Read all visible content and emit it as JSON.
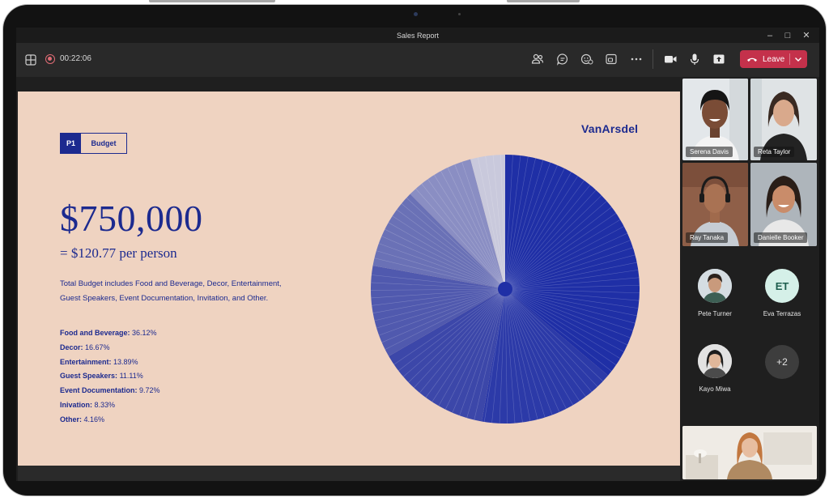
{
  "window": {
    "title": "Sales Report"
  },
  "toolbar": {
    "timer": "00:22:06",
    "leave_label": "Leave",
    "icons": [
      "grid-icon",
      "record-icon",
      "people-icon",
      "chat-icon",
      "reactions-icon",
      "view-icon",
      "more-icon",
      "camera-icon",
      "mic-icon",
      "share-icon",
      "phone-icon",
      "chevron-down-icon"
    ]
  },
  "slide": {
    "badge_tag": "P1",
    "badge_name": "Budget",
    "logo": "VanArsdel",
    "amount": "$750,000",
    "per_person": "= $120.77 per person",
    "description": "Total Budget includes Food and Beverage, Decor, Entertainment, Guest Speakers, Event Documentation, Invitation, and Other.",
    "breakdown": [
      {
        "label": "Food and Beverage:",
        "value": "36.12%"
      },
      {
        "label": "Decor:",
        "value": "16.67%"
      },
      {
        "label": "Entertainment:",
        "value": "13.89%"
      },
      {
        "label": "Guest Speakers:",
        "value": "11.11%"
      },
      {
        "label": "Event Documentation:",
        "value": "9.72%"
      },
      {
        "label": "Inivation:",
        "value": "8.33%"
      },
      {
        "label": "Other:",
        "value": "4.16%"
      }
    ]
  },
  "chart_data": {
    "type": "pie",
    "categories": [
      "Food and Beverage",
      "Decor",
      "Entertainment",
      "Guest Speakers",
      "Event Documentation",
      "Inivation",
      "Other"
    ],
    "values": [
      36.12,
      16.67,
      13.89,
      11.11,
      9.72,
      8.33,
      4.16
    ],
    "colors": [
      "#1f2fa6",
      "#2c3aa8",
      "#3c47a9",
      "#5059ae",
      "#6a71b6",
      "#8a8ec3",
      "#c9c9dc"
    ]
  },
  "participants": {
    "video_tiles": [
      {
        "name": "Serena Davis"
      },
      {
        "name": "Reta Taylor"
      },
      {
        "name": "Ray Tanaka"
      },
      {
        "name": "Danielle Booker"
      }
    ],
    "avatars": [
      {
        "name": "Pete Turner"
      },
      {
        "name": "Eva Terrazas",
        "initials": "ET"
      },
      {
        "name": "Kayo Miwa"
      }
    ],
    "overflow_count": "+2"
  }
}
